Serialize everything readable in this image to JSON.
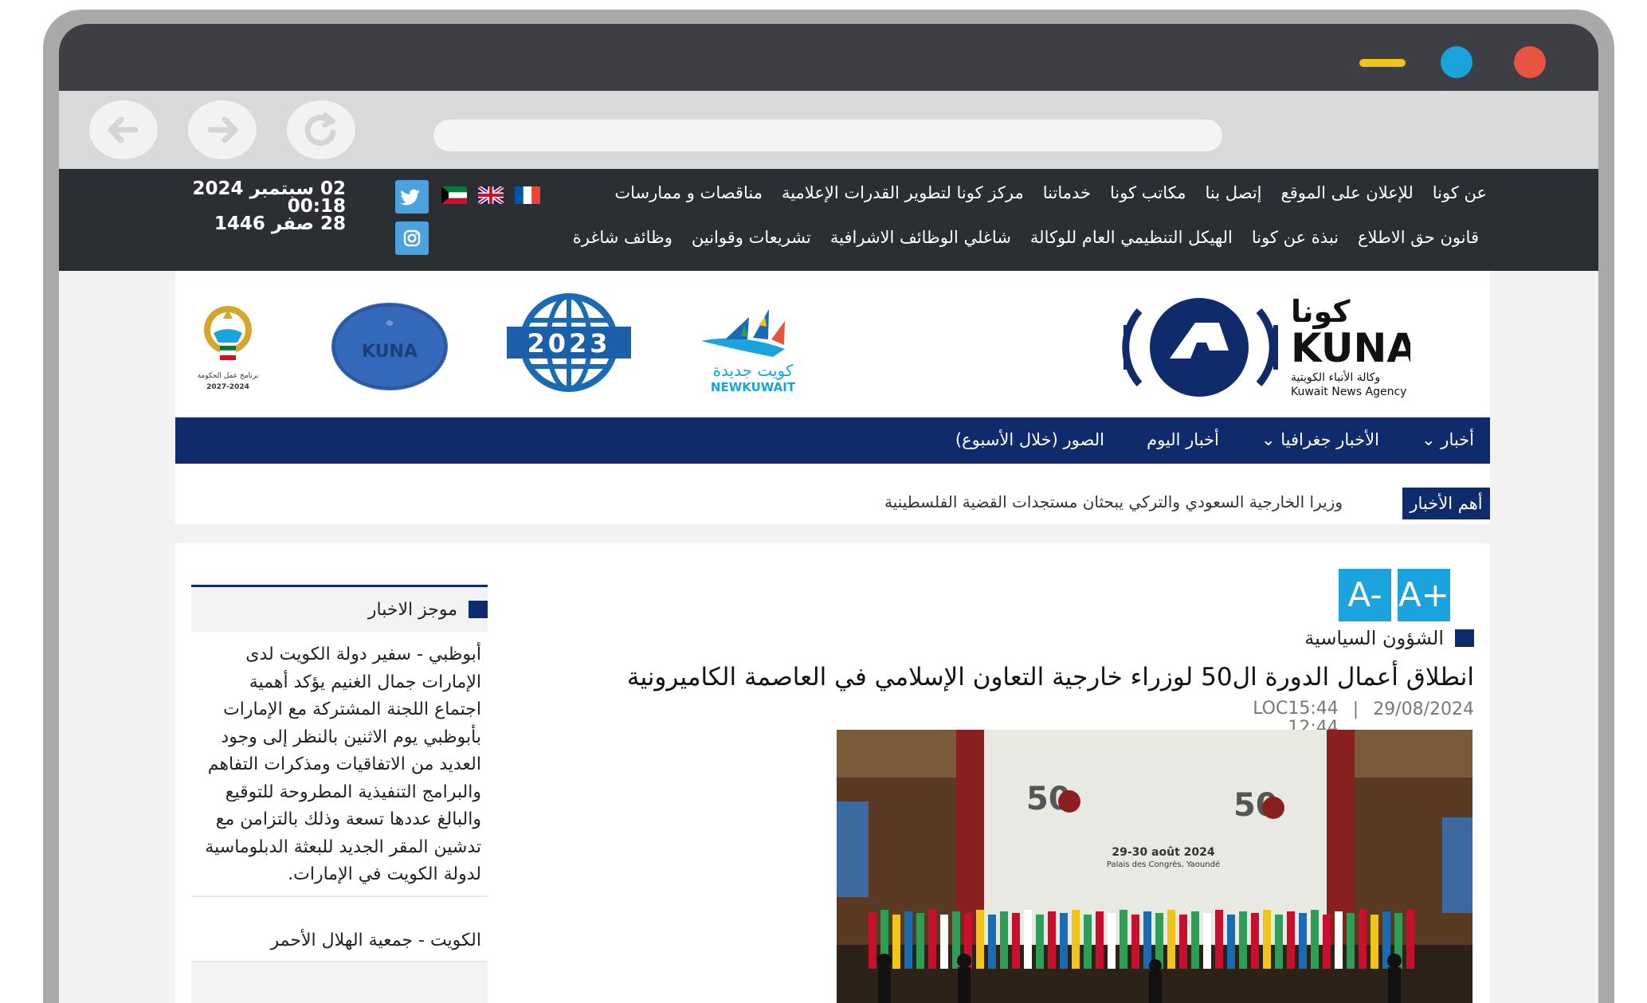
{
  "topbar": {
    "menu_row1": [
      "عن كونا",
      "للإعلان على الموقع",
      "إتصل بنا",
      "مكاتب كونا",
      "خدماتنا",
      "مركز كونا لتطوير القدرات الإعلامية",
      "مناقصات و ممارسات"
    ],
    "menu_row2": [
      "قانون حق الاطلاع",
      "نبذة عن كونا",
      "الهيكل التنظيمي العام للوكالة",
      "شاغلي الوظائف الاشرافية",
      "تشريعات وقوانين",
      "وظائف شاغرة"
    ],
    "date_gregorian": "02 سبتمبر 2024 00:18",
    "date_hijri": "28 صفر 1446"
  },
  "header": {
    "logo_ar": "كونا",
    "logo_en": "KUNA",
    "logo_sub_ar": "وكالة الأنباء الكويتية",
    "logo_sub_en": "Kuwait News Agency",
    "newkuwait_ar": "كويت جديدة",
    "newkuwait_en": "NEWKUWAIT",
    "year_badge": "2023",
    "kuna_badge": "KUNA",
    "gov_text_1": "برنامج عمل الحكومة",
    "gov_text_2": "2027-2024"
  },
  "main_nav": {
    "items": [
      "أخبار",
      "الأخبار جغرافيا",
      "أخبار اليوم",
      "الصور (خلال الأسبوع)"
    ]
  },
  "ticker": {
    "label": "أهم الأخبار",
    "text": "وزيرا الخارجية السعودي والتركي يبحثان مستجدات القضية الفلسطينية"
  },
  "article": {
    "font_increase": "A+",
    "font_decrease": "A-",
    "section": "الشؤون السياسية",
    "headline": "انطلاق أعمال الدورة ال50 لوزراء خارجية التعاون الإسلامي في العاصمة الكاميرونية",
    "date": "29/08/2024",
    "loc_time": "LOC15:44",
    "time": "12:44",
    "photo_banner_date": "29-30 août 2024",
    "photo_banner_venue": "Palais des Congrès, Yaoundé"
  },
  "sidebar": {
    "title": "موجز الاخبار",
    "items": [
      "أبوظبي - سفير دولة الكويت لدى الإمارات جمال الغنيم يؤكد أهمية اجتماع اللجنة المشتركة مع الإمارات بأبوظبي يوم الاثنين بالنظر إلى وجود العديد من الاتفاقيات ومذكرات التفاهم والبرامج التنفيذية المطروحة للتوقيع والبالغ عددها تسعة وذلك بالتزامن مع تدشين المقر الجديد للبعثة الدبلوماسية لدولة الكويت في الإمارات.",
      "الكويت - جمعية الهلال الأحمر"
    ]
  },
  "colors": {
    "navy": "#102b6b",
    "accent_blue": "#1aa3dc",
    "topbar_bg": "#2b2e33"
  }
}
